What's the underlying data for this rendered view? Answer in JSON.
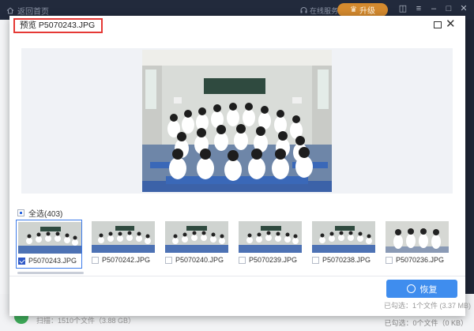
{
  "app": {
    "back_label": "返回首页",
    "online_label": "在线服务",
    "upgrade_label": "升级",
    "footer_scan": "扫描：1510个文件（3.88 GB）",
    "footer_selected": "已勾选：0个文件（0 KB）"
  },
  "dialog": {
    "title": "预览 P5070243.JPG",
    "select_all_label": "全选(403)",
    "thumbnails": [
      {
        "name": "P5070243.JPG",
        "checked": true
      },
      {
        "name": "P5070242.JPG",
        "checked": false
      },
      {
        "name": "P5070240.JPG",
        "checked": false
      },
      {
        "name": "P5070239.JPG",
        "checked": false
      },
      {
        "name": "P5070238.JPG",
        "checked": false
      },
      {
        "name": "P5070236.JPG",
        "checked": false
      }
    ],
    "recover_label": "恢复",
    "status_text": "已勾选：1个文件 (3.37 MB)"
  },
  "colors": {
    "accent": "#3f8dee",
    "title_highlight": "#e53935",
    "upgrade": "#d48a2e"
  }
}
